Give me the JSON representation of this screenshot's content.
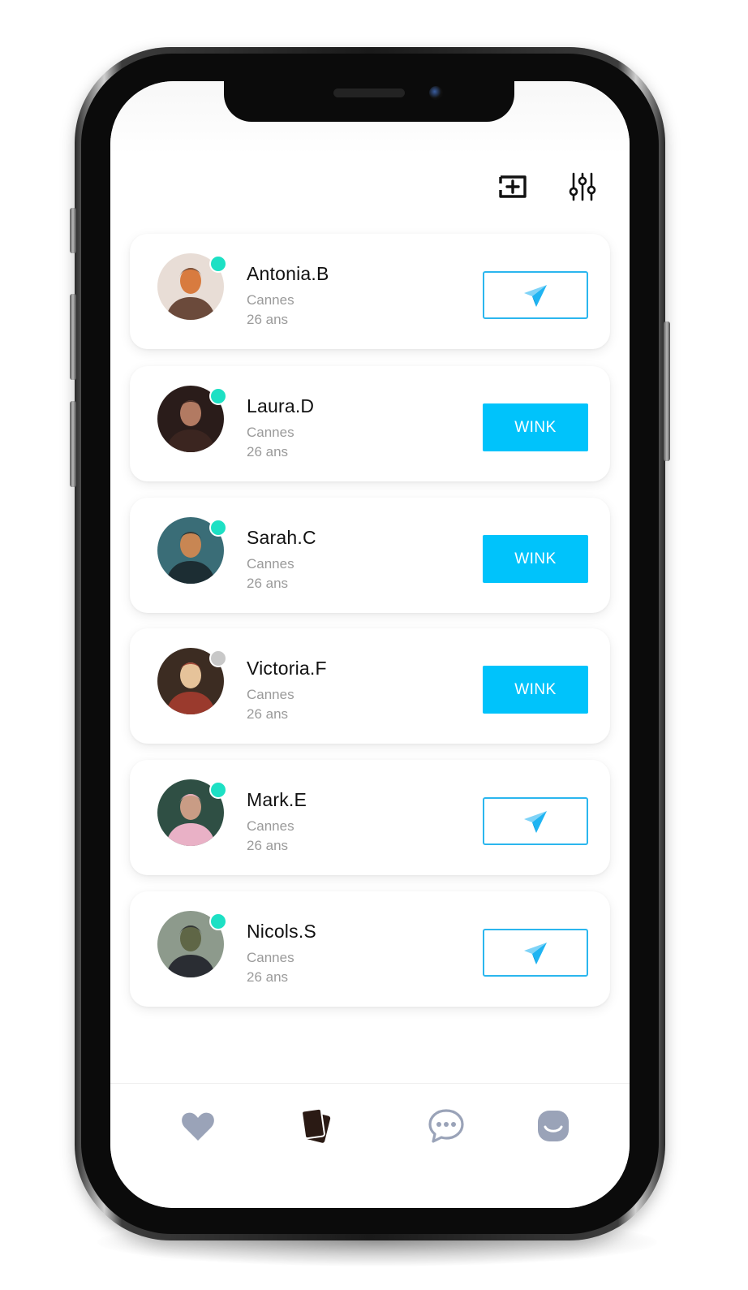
{
  "header": {
    "icons": [
      "add-story-icon",
      "filter-sliders-icon"
    ]
  },
  "profiles": [
    {
      "name": "Antonia.B",
      "city": "Cannes",
      "age": "26 ans",
      "status": "online",
      "action": "send",
      "avatar_palette": [
        "#e8ddd6",
        "#d87b3f",
        "#6b4a3b"
      ]
    },
    {
      "name": "Laura.D",
      "city": "Cannes",
      "age": "26 ans",
      "status": "online",
      "action": "wink",
      "action_label": "WINK",
      "avatar_palette": [
        "#2a1c1a",
        "#b27a62",
        "#3b2520"
      ]
    },
    {
      "name": "Sarah.C",
      "city": "Cannes",
      "age": "26 ans",
      "status": "online",
      "action": "wink",
      "action_label": "WINK",
      "avatar_palette": [
        "#3a6d77",
        "#c88653",
        "#1c2d33"
      ]
    },
    {
      "name": "Victoria.F",
      "city": "Cannes",
      "age": "26 ans",
      "status": "offline",
      "action": "wink",
      "action_label": "WINK",
      "avatar_palette": [
        "#3c2c22",
        "#e6c39a",
        "#9a3a2d"
      ]
    },
    {
      "name": "Mark.E",
      "city": "Cannes",
      "age": "26 ans",
      "status": "online",
      "action": "send",
      "avatar_palette": [
        "#2f4f44",
        "#c99c85",
        "#e9b1c6"
      ]
    },
    {
      "name": "Nicols.S",
      "city": "Cannes",
      "age": "26 ans",
      "status": "online",
      "action": "send",
      "avatar_palette": [
        "#8d9a8c",
        "#5f6646",
        "#2a2d33"
      ]
    }
  ],
  "tabbar": {
    "tabs": [
      "heart-icon",
      "cards-icon",
      "chat-icon",
      "profile-face-icon"
    ],
    "active": "cards-icon"
  },
  "colors": {
    "accent": "#00c3fb",
    "send_border": "#2bb6ee",
    "online": "#1de0c4",
    "offline": "#c8c8c8",
    "inactive_tab": "#9aa3b8",
    "active_tab": "#2a1a14"
  }
}
